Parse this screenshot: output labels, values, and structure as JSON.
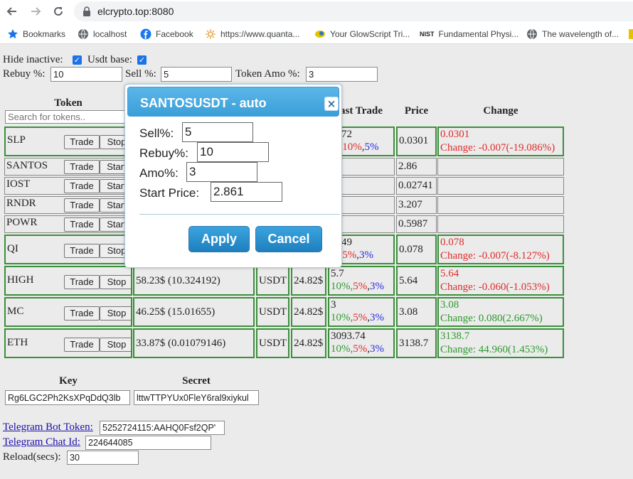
{
  "browser": {
    "url": "elcrypto.top:8080",
    "bookmarks": [
      {
        "label": "Bookmarks",
        "icon": "star-icon"
      },
      {
        "label": "localhost",
        "icon": "globe-icon"
      },
      {
        "label": "Facebook",
        "icon": "facebook-icon"
      },
      {
        "label": "https://www.quanta...",
        "icon": "sun-icon"
      },
      {
        "label": "Your GlowScript Tri...",
        "icon": "glowscript-icon"
      },
      {
        "label": "Fundamental Physi...",
        "icon": "nist-icon",
        "badge": "NIST"
      },
      {
        "label": "The wavelength of...",
        "icon": "globe-icon"
      }
    ]
  },
  "settings": {
    "hide_inactive_label": "Hide inactive:",
    "usdt_base_label": "Usdt base:",
    "rebuy_label": "Rebuy %:",
    "rebuy_value": "10",
    "sell_label": "Sell %:",
    "sell_value": "5",
    "token_amo_label": "Token Amo %:",
    "token_amo_value": "3"
  },
  "table": {
    "headers": {
      "token": "Token",
      "last_trade": "ast Trade",
      "price": "Price",
      "change": "Change"
    },
    "search_placeholder": "Search for tokens..",
    "trade_label": "Trade",
    "rows": [
      {
        "token": "SLP",
        "action": "Stop",
        "lt_value": "0372",
        "lt_p1": "%,",
        "lt_p2": "10%",
        "lt_p3": "5%",
        "price": "0.0301",
        "change_val": "0.0301",
        "change_text": "Change: -0.007(-19.086%)",
        "change_color": "red"
      },
      {
        "token": "SANTOS",
        "action": "Start",
        "price": "2.86"
      },
      {
        "token": "IOST",
        "action": "Start",
        "price": "0.02741"
      },
      {
        "token": "RNDR",
        "action": "Start",
        "price": "3.207"
      },
      {
        "token": "POWR",
        "action": "Start",
        "price": "0.5987"
      },
      {
        "token": "QI",
        "action": "Stop",
        "lt_value": "0849",
        "lt_p1": "%,",
        "lt_p2": "5%",
        "lt_p3": "3%",
        "price": "0.078",
        "change_val": "0.078",
        "change_text": "Change: -0.007(-8.127%)",
        "change_color": "red"
      },
      {
        "token": "HIGH",
        "action": "Stop",
        "holding": "58.23$ (10.324192)",
        "base": "USDT",
        "value": "24.82$",
        "lt_value": "5.7",
        "lt_p1": "10%,",
        "lt_p2": "5%",
        "lt_p3": "3%",
        "price": "5.64",
        "change_val": "5.64",
        "change_text": "Change: -0.060(-1.053%)",
        "change_color": "red"
      },
      {
        "token": "MC",
        "action": "Stop",
        "holding": "46.25$ (15.01655)",
        "base": "USDT",
        "value": "24.82$",
        "lt_value": "3",
        "lt_p1": "10%,",
        "lt_p2": "5%",
        "lt_p3": "3%",
        "price": "3.08",
        "change_val": "3.08",
        "change_text": "Change: 0.080(2.667%)",
        "change_color": "green"
      },
      {
        "token": "ETH",
        "action": "Stop",
        "holding": "33.87$ (0.01079146)",
        "base": "USDT",
        "value": "24.82$",
        "lt_value": "3093.74",
        "lt_p1": "10%,",
        "lt_p2": "5%",
        "lt_p3": "3%",
        "price": "3138.7",
        "change_val": "3138.7",
        "change_text": "Change: 44.960(1.453%)",
        "change_color": "green"
      }
    ]
  },
  "keys": {
    "key_label": "Key",
    "secret_label": "Secret",
    "key_value": "Rg6LGC2Ph2KsXPqDdQ3lb",
    "secret_value": "lttwTTPYUx0FleY6ral9xiykul"
  },
  "telegram": {
    "bot_token_label": "Telegram Bot Token:",
    "bot_token_value": "5252724115:AAHQ0Fsf2QP'",
    "chat_id_label": "Telegram Chat Id:",
    "chat_id_value": "224644085",
    "reload_label": "Reload(secs):",
    "reload_value": "30"
  },
  "modal": {
    "title": "SANTOSUSDT - auto",
    "sell_label": "Sell%:",
    "sell_value": "5",
    "rebuy_label": "Rebuy%:",
    "rebuy_value": "10",
    "amo_label": "Amo%:",
    "amo_value": "3",
    "start_price_label": "Start Price:",
    "start_price_value": "2.861",
    "apply_label": "Apply",
    "cancel_label": "Cancel",
    "close_glyph": "×"
  },
  "colors": {
    "accent": "#3a9fd8",
    "border_green": "#3b8e3b",
    "down": "#e02b2b",
    "up": "#2c9a2c",
    "link": "#1a0dab"
  }
}
